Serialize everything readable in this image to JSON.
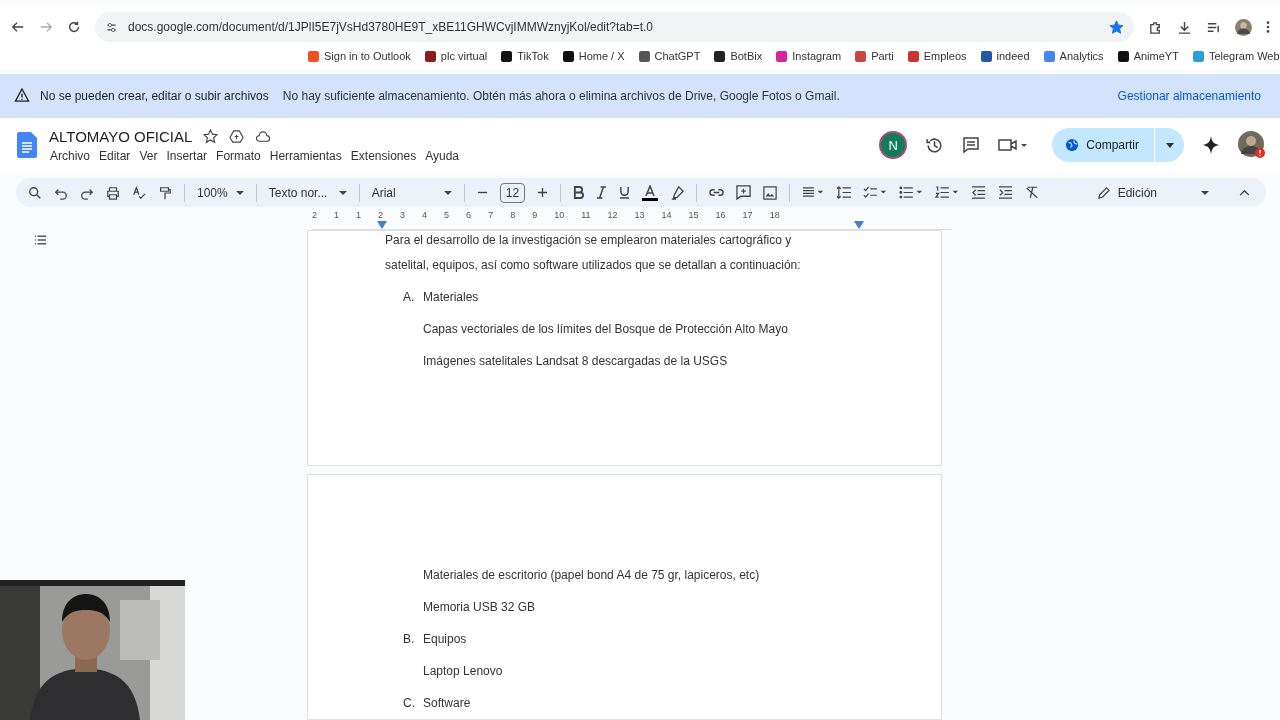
{
  "browser": {
    "url": "docs.google.com/document/d/1JPlI5E7jVsHd3780HE9T_xBE11GHWCvjIMMWznyjKol/edit?tab=t.0",
    "bookmarked": true
  },
  "bookmarks": [
    {
      "label": "Sign in to Outlook"
    },
    {
      "label": "plc virtual"
    },
    {
      "label": "TikTok"
    },
    {
      "label": "Home / X"
    },
    {
      "label": "ChatGPT"
    },
    {
      "label": "BotBix"
    },
    {
      "label": "Instagram"
    },
    {
      "label": "Parti"
    },
    {
      "label": "Empleos"
    },
    {
      "label": "indeed"
    },
    {
      "label": "Analytics"
    },
    {
      "label": "AnimeYT"
    },
    {
      "label": "Telegram Web"
    }
  ],
  "banner": {
    "title": "No se pueden crear, editar o subir archivos",
    "message": "No hay suficiente almacenamiento. Obtén más ahora o elimina archivos de Drive, Google Fotos o Gmail.",
    "action": "Gestionar almacenamiento"
  },
  "doc": {
    "title": "ALTOMAYO OFICIAL",
    "starred": false,
    "menu": [
      "Archivo",
      "Editar",
      "Ver",
      "Insertar",
      "Formato",
      "Herramientas",
      "Extensiones",
      "Ayuda"
    ],
    "avatar": "N",
    "share": "Compartir"
  },
  "toolbar": {
    "zoom": "100%",
    "style": "Texto nor...",
    "font": "Arial",
    "size": "12",
    "mode": "Edición"
  },
  "ruler": [
    "2",
    "1",
    "1",
    "2",
    "3",
    "4",
    "5",
    "6",
    "7",
    "8",
    "9",
    "10",
    "11",
    "12",
    "13",
    "14",
    "15",
    "16",
    "17",
    "18"
  ],
  "pages": [
    [
      {
        "kind": "para",
        "text": "Para el desarrollo de la investigación se emplearon materiales cartográfico y"
      },
      {
        "kind": "para",
        "text": "satelital, equipos, así como software utilizados que se detallan a continuación:"
      },
      {
        "kind": "heading",
        "marker": "A.",
        "text": "Materiales"
      },
      {
        "kind": "item",
        "text": "Capas vectoriales de los límites del Bosque de Protección Alto Mayo"
      },
      {
        "kind": "item",
        "text": "Imágenes satelitales Landsat 8 descargadas de la USGS"
      }
    ],
    [
      {
        "kind": "item",
        "text": "Materiales de escritorio (papel bond A4 de 75 gr, lapiceros, etc)"
      },
      {
        "kind": "item",
        "text": "Memoria USB 32 GB"
      },
      {
        "kind": "heading",
        "marker": "B.",
        "text": "Equipos"
      },
      {
        "kind": "item",
        "text": "Laptop Lenovo"
      },
      {
        "kind": "heading",
        "marker": "C.",
        "text": "Software"
      }
    ]
  ]
}
